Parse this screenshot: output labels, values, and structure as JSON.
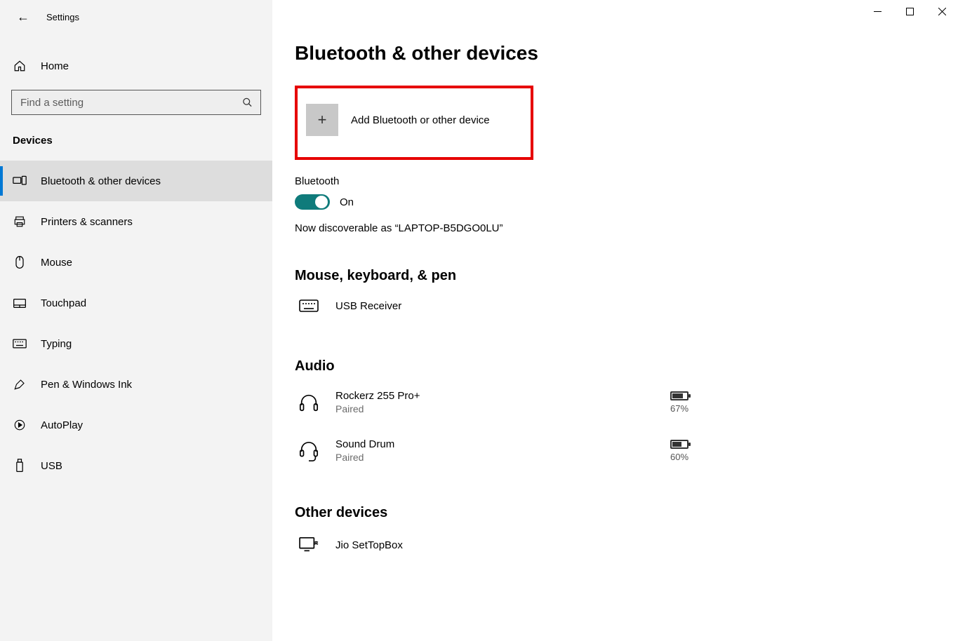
{
  "window": {
    "title": "Settings"
  },
  "sidebar": {
    "home": "Home",
    "search_placeholder": "Find a setting",
    "category": "Devices",
    "items": [
      {
        "label": "Bluetooth & other devices",
        "active": true
      },
      {
        "label": "Printers & scanners"
      },
      {
        "label": "Mouse"
      },
      {
        "label": "Touchpad"
      },
      {
        "label": "Typing"
      },
      {
        "label": "Pen & Windows Ink"
      },
      {
        "label": "AutoPlay"
      },
      {
        "label": "USB"
      }
    ]
  },
  "main": {
    "title": "Bluetooth & other devices",
    "add_device": "Add Bluetooth or other device",
    "bluetooth_label": "Bluetooth",
    "bluetooth_state": "On",
    "discoverable_text": "Now discoverable as “LAPTOP-B5DGO0LU”",
    "sections": {
      "mouse_kb": {
        "title": "Mouse, keyboard, & pen",
        "items": [
          {
            "name": "USB Receiver"
          }
        ]
      },
      "audio": {
        "title": "Audio",
        "items": [
          {
            "name": "Rockerz 255 Pro+",
            "status": "Paired",
            "battery": "67%",
            "battery_fill": 67
          },
          {
            "name": "Sound Drum",
            "status": "Paired",
            "battery": "60%",
            "battery_fill": 60
          }
        ]
      },
      "other": {
        "title": "Other devices",
        "items": [
          {
            "name": "Jio SetTopBox"
          }
        ]
      }
    }
  },
  "annotation": {
    "highlight_color": "#e60000"
  }
}
